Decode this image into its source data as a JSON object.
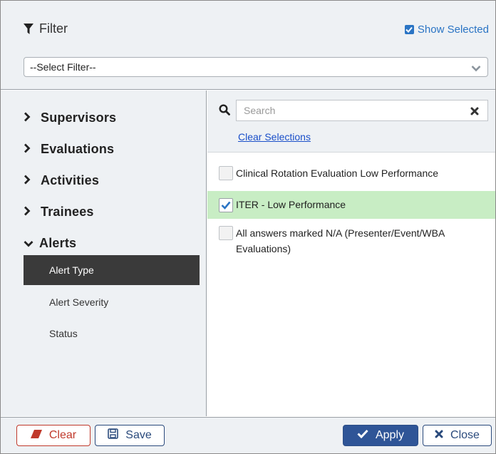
{
  "header": {
    "title": "Filter",
    "show_selected_label": "Show Selected",
    "select_filter_value": "--Select Filter--"
  },
  "nav": {
    "categories": [
      {
        "label": "Supervisors",
        "expanded": false
      },
      {
        "label": "Evaluations",
        "expanded": false
      },
      {
        "label": "Activities",
        "expanded": false
      },
      {
        "label": "Trainees",
        "expanded": false
      },
      {
        "label": "Alerts",
        "expanded": true
      }
    ],
    "alert_items": [
      {
        "label": "Alert Type",
        "active": true
      },
      {
        "label": "Alert Severity",
        "active": false
      },
      {
        "label": "Status",
        "active": false
      }
    ]
  },
  "search": {
    "placeholder": "Search",
    "clear_selections_label": "Clear Selections"
  },
  "options": [
    {
      "label": "Clinical Rotation Evaluation Low Performance",
      "checked": false
    },
    {
      "label": "ITER - Low Performance",
      "checked": true
    },
    {
      "label": "All answers marked N/A (Presenter/Event/WBA Evaluations)",
      "checked": false
    }
  ],
  "footer": {
    "clear_label": "Clear",
    "save_label": "Save",
    "apply_label": "Apply",
    "close_label": "Close"
  },
  "colors": {
    "accent": "#2a74c4",
    "selected_row": "#c8edc4",
    "active_nav": "#3a3a3a",
    "danger": "#c0392b",
    "primary": "#2f5597"
  }
}
